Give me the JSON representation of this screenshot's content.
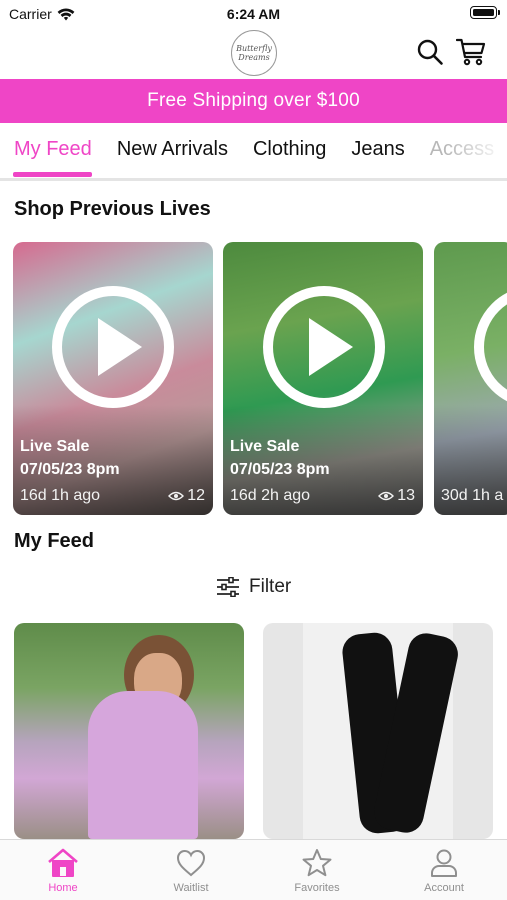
{
  "status_bar": {
    "carrier": "Carrier",
    "time": "6:24 AM"
  },
  "header": {
    "logo_text": "Butterfly Dreams"
  },
  "banner": {
    "text": "Free Shipping over $100",
    "color": "#ef45c6"
  },
  "tabs": [
    {
      "label": "My Feed",
      "active": true
    },
    {
      "label": "New Arrivals",
      "active": false
    },
    {
      "label": "Clothing",
      "active": false
    },
    {
      "label": "Jeans",
      "active": false
    },
    {
      "label": "Access",
      "active": false
    }
  ],
  "lives_section": {
    "title": "Shop Previous Lives",
    "cards": [
      {
        "label": "Live Sale",
        "date": "07/05/23 8pm",
        "ago": "16d 1h ago",
        "views": "12"
      },
      {
        "label": "Live Sale",
        "date": "07/05/23 8pm",
        "ago": "16d 2h ago",
        "views": "13"
      },
      {
        "label": "",
        "date": "",
        "ago": "30d 1h a",
        "views": ""
      }
    ]
  },
  "feed_section": {
    "title": "My Feed",
    "filter_label": "Filter"
  },
  "tabbar": {
    "items": [
      {
        "label": "Home",
        "icon": "home-icon",
        "active": true
      },
      {
        "label": "Waitlist",
        "icon": "heart-icon",
        "active": false
      },
      {
        "label": "Favorites",
        "icon": "star-icon",
        "active": false
      },
      {
        "label": "Account",
        "icon": "person-icon",
        "active": false
      }
    ]
  },
  "colors": {
    "accent": "#ef45c6"
  }
}
